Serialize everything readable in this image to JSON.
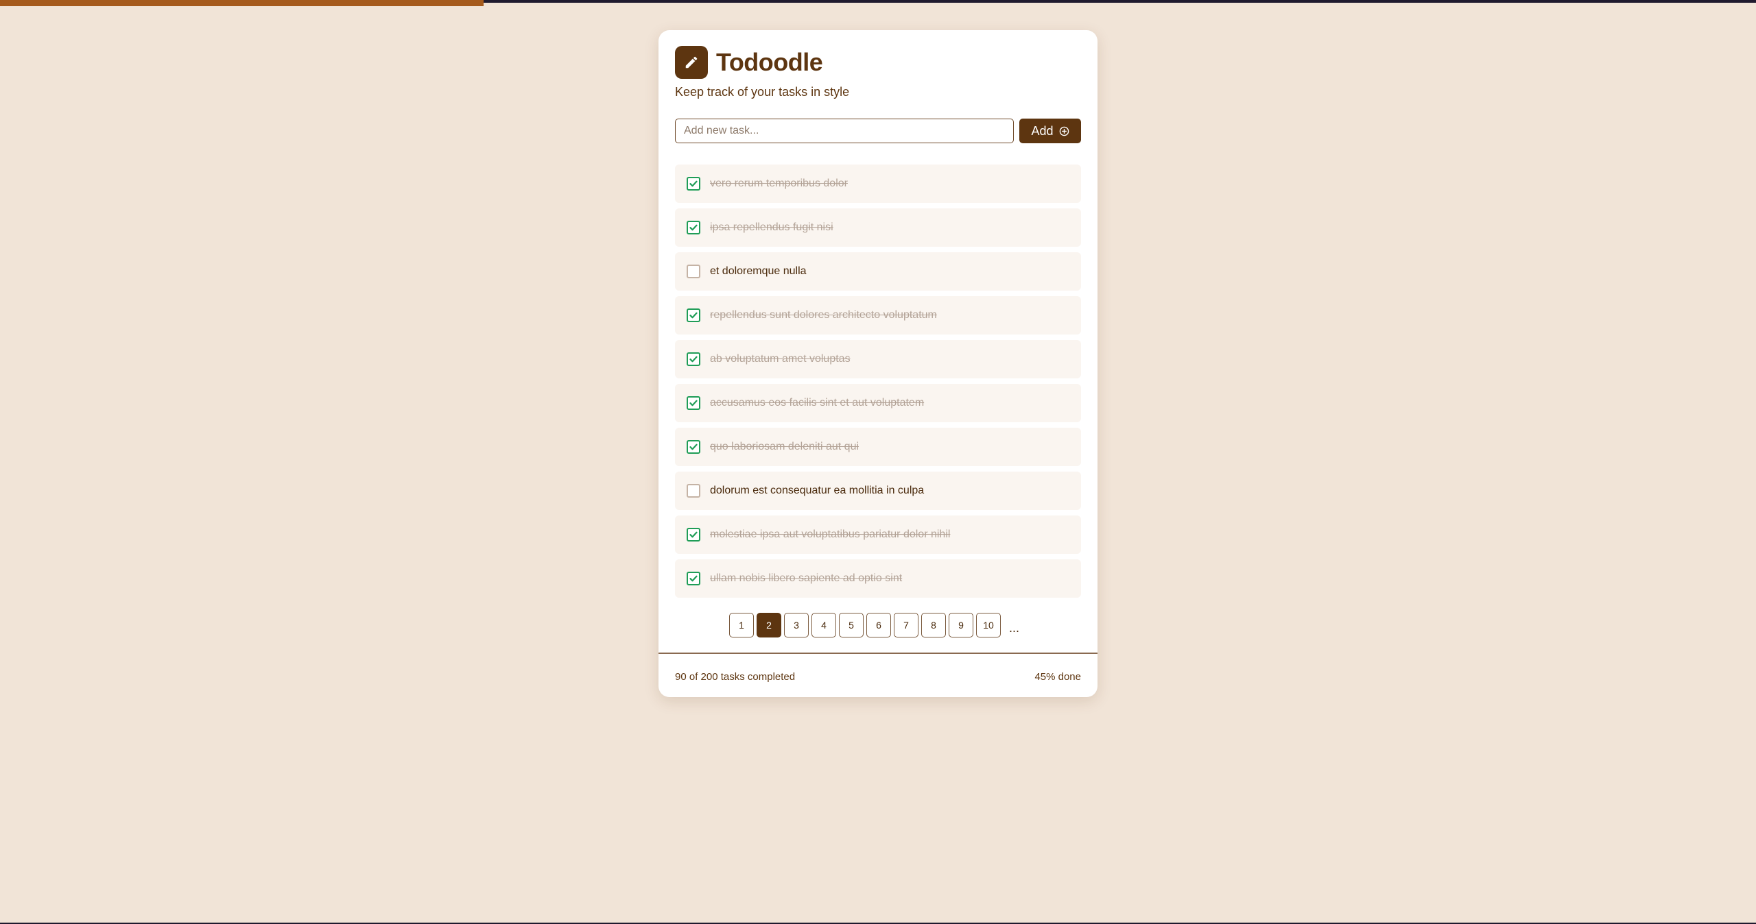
{
  "app": {
    "title": "Todoodle",
    "subtitle": "Keep track of your tasks in style",
    "logo_icon": "pencil-icon"
  },
  "progress": {
    "fraction": 0.45
  },
  "add_task": {
    "placeholder": "Add new task...",
    "value": "",
    "button_label": "Add",
    "button_icon": "plus-circle-icon"
  },
  "tasks": [
    {
      "text": "vero rerum temporibus dolor",
      "done": true
    },
    {
      "text": "ipsa repellendus fugit nisi",
      "done": true
    },
    {
      "text": "et doloremque nulla",
      "done": false
    },
    {
      "text": "repellendus sunt dolores architecto voluptatum",
      "done": true
    },
    {
      "text": "ab voluptatum amet voluptas",
      "done": true
    },
    {
      "text": "accusamus eos facilis sint et aut voluptatem",
      "done": true
    },
    {
      "text": "quo laboriosam deleniti aut qui",
      "done": true
    },
    {
      "text": "dolorum est consequatur ea mollitia in culpa",
      "done": false
    },
    {
      "text": "molestiae ipsa aut voluptatibus pariatur dolor nihil",
      "done": true
    },
    {
      "text": "ullam nobis libero sapiente ad optio sint",
      "done": true
    }
  ],
  "pagination": {
    "pages": [
      "1",
      "2",
      "3",
      "4",
      "5",
      "6",
      "7",
      "8",
      "9",
      "10"
    ],
    "current": "2",
    "ellipsis": "..."
  },
  "footer": {
    "summary": "90 of 200 tasks completed",
    "percent": "45% done"
  },
  "colors": {
    "background": "#f1e4d7",
    "accent": "#5d3510",
    "progress": "#a55a1c",
    "check": "#1f9d57"
  }
}
